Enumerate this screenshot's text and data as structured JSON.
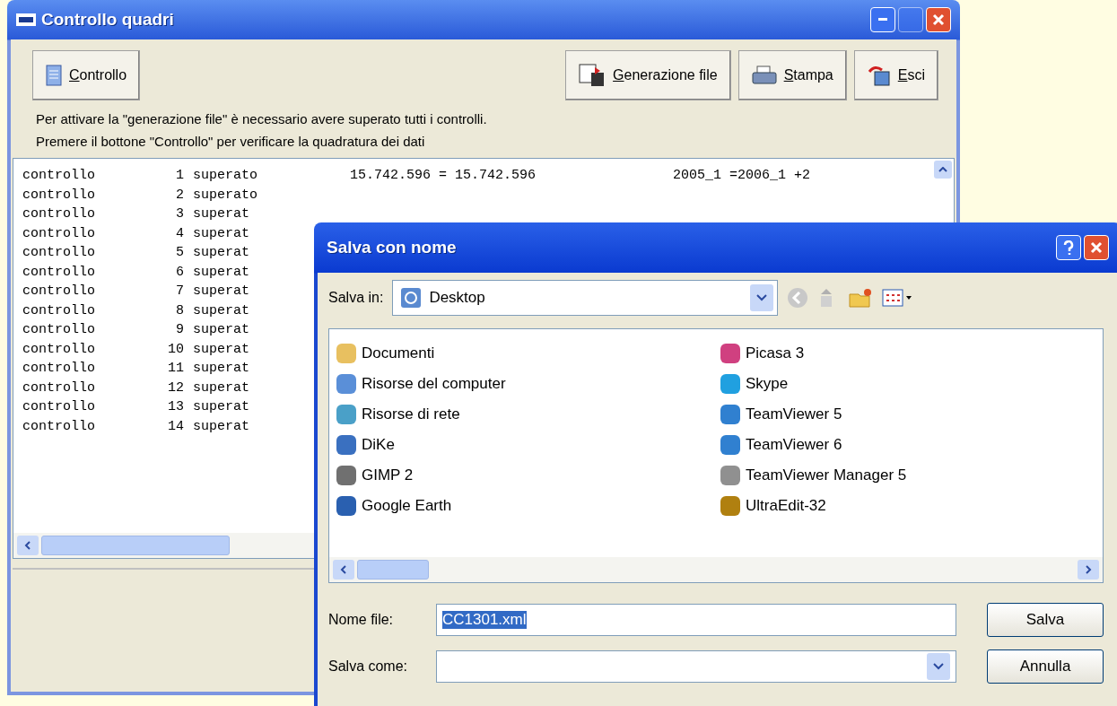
{
  "main_window": {
    "title": "Controllo quadri",
    "toolbar": [
      {
        "label": "Controllo",
        "kind": "check"
      },
      {
        "label": "Generazione file",
        "kind": "generate"
      },
      {
        "label": "Stampa",
        "kind": "print"
      },
      {
        "label": "Esci",
        "kind": "exit"
      }
    ],
    "messages": [
      "Per attivare la \"generazione file\" è necessario avere superato tutti i controlli.",
      "Premere il bottone \"Controllo\"  per verificare la quadratura dei dati"
    ],
    "rows": [
      {
        "column_1": "controllo",
        "column_2": "1",
        "column_3": "superato",
        "column_4": "15.742.596 = 15.742.596",
        "column_5": "2005_1 =2006_1 +2"
      },
      {
        "column_1": "controllo",
        "column_2": "2",
        "column_3": "superato"
      },
      {
        "column_1": "controllo",
        "column_2": "3",
        "column_3": "superat"
      },
      {
        "column_1": "controllo",
        "column_2": "4",
        "column_3": "superat"
      },
      {
        "column_1": "controllo",
        "column_2": "5",
        "column_3": "superat"
      },
      {
        "column_1": "controllo",
        "column_2": "6",
        "column_3": "superat"
      },
      {
        "column_1": "controllo",
        "column_2": "7",
        "column_3": "superat"
      },
      {
        "column_1": "controllo",
        "column_2": "8",
        "column_3": "superat"
      },
      {
        "column_1": "controllo",
        "column_2": "9",
        "column_3": "superat"
      },
      {
        "column_1": "controllo",
        "column_2": "10",
        "column_3": "superat"
      },
      {
        "column_1": "controllo",
        "column_2": "11",
        "column_3": "superat"
      },
      {
        "column_1": "controllo",
        "column_2": "12",
        "column_3": "superat"
      },
      {
        "column_1": "controllo",
        "column_2": "13",
        "column_3": "superat"
      },
      {
        "column_1": "controllo",
        "column_2": "14",
        "column_3": "superat"
      }
    ]
  },
  "dialog": {
    "title": "Salva con nome",
    "save_in_label": "Salva in:",
    "save_in_value": "Desktop",
    "files": [
      {
        "name": "Documenti",
        "color": "#e8c060"
      },
      {
        "name": "Risorse del computer",
        "color": "#5a8fd8"
      },
      {
        "name": "Risorse di rete",
        "color": "#4aa0c8"
      },
      {
        "name": "DiKe",
        "color": "#3a70c0"
      },
      {
        "name": "GIMP 2",
        "color": "#707070"
      },
      {
        "name": "Google Earth",
        "color": "#2a60b0"
      },
      {
        "name": "Picasa 3",
        "color": "#d04080"
      },
      {
        "name": "Skype",
        "color": "#20a0e0"
      },
      {
        "name": "TeamViewer 5",
        "color": "#3080d0"
      },
      {
        "name": "TeamViewer 6",
        "color": "#3080d0"
      },
      {
        "name": "TeamViewer Manager 5",
        "color": "#909090"
      },
      {
        "name": "UltraEdit-32",
        "color": "#b08010"
      }
    ],
    "file_name_label": "Nome file:",
    "file_name_value": "CC1301.xml",
    "save_as_label": "Salva come:",
    "buttons": [
      "Salva",
      "Annulla"
    ]
  }
}
